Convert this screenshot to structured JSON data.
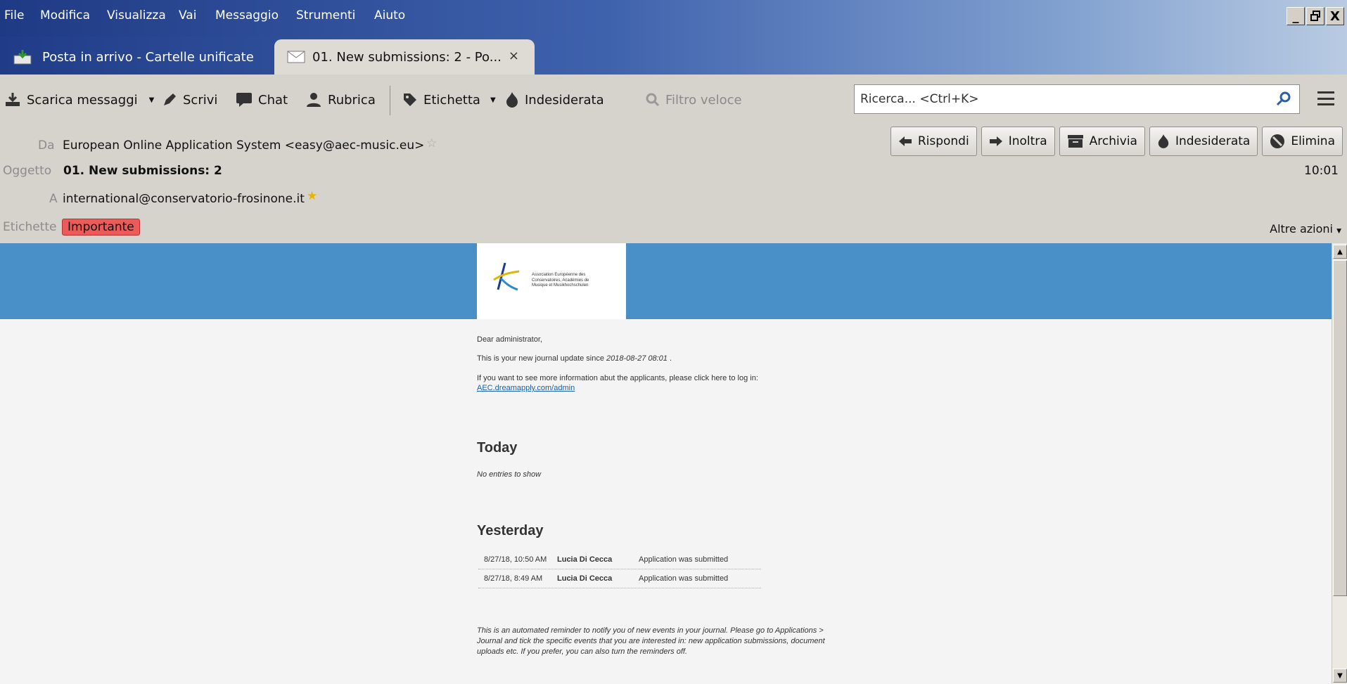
{
  "menu": [
    "File",
    "Modifica",
    "Visualizza",
    "Vai",
    "Messaggio",
    "Strumenti",
    "Aiuto"
  ],
  "window_controls": {
    "minimize": "_",
    "maximize": "🗗",
    "close": "X"
  },
  "tabs": [
    {
      "label": "Posta in arrivo - Cartelle unificate",
      "active": false
    },
    {
      "label": "01. New submissions: 2 - Po...",
      "active": true,
      "close": "×"
    }
  ],
  "toolbar": {
    "download": "Scarica messaggi",
    "write": "Scrivi",
    "chat": "Chat",
    "addressbook": "Rubrica",
    "tag": "Etichetta",
    "junk": "Indesiderata",
    "quick_filter": "Filtro veloce",
    "search_placeholder": "Ricerca... <Ctrl+K>"
  },
  "header": {
    "from_label": "Da",
    "from": "European Online Application System <easy@aec-music.eu>",
    "subject_label": "Oggetto",
    "subject": "01. New submissions: 2",
    "time": "10:01",
    "to_label": "A",
    "to": "international@conservatorio-frosinone.it",
    "tags_label": "Etichette",
    "tag": "Importante",
    "more_actions": "Altre azioni",
    "buttons": {
      "reply": "Rispondi",
      "forward": "Inoltra",
      "archive": "Archivia",
      "junk": "Indesiderata",
      "delete": "Elimina"
    }
  },
  "message": {
    "logo_text": [
      "Association Européenne des",
      "Conservatoires, Académies de",
      "Musique et Musikhochschulen"
    ],
    "greeting": "Dear administrator,",
    "update_prefix": "This is your new journal update since ",
    "update_date": "2018-08-27 08:01",
    "update_suffix": " .",
    "info": "If you want to see more information abut the applicants, please click here to log in:",
    "link": "AEC.dreamapply.com/admin",
    "today_heading": "Today",
    "today_empty": "No entries to show",
    "yesterday_heading": "Yesterday",
    "entries": [
      {
        "time": "8/27/18, 10:50 AM",
        "name": "Lucia Di Cecca",
        "event": "Application was submitted"
      },
      {
        "time": "8/27/18, 8:49 AM",
        "name": "Lucia Di Cecca",
        "event": "Application was submitted"
      }
    ],
    "footer": "This is an automated reminder to notify you of new events in your journal. Please go to Applications > Journal and tick the specific events that you are interested in: new application submissions, document uploads etc. If you prefer, you can also turn the reminders off."
  },
  "colors": {
    "banner": "#4a90c8",
    "tag": "#ec5a5a",
    "link": "#1a5fa8"
  }
}
